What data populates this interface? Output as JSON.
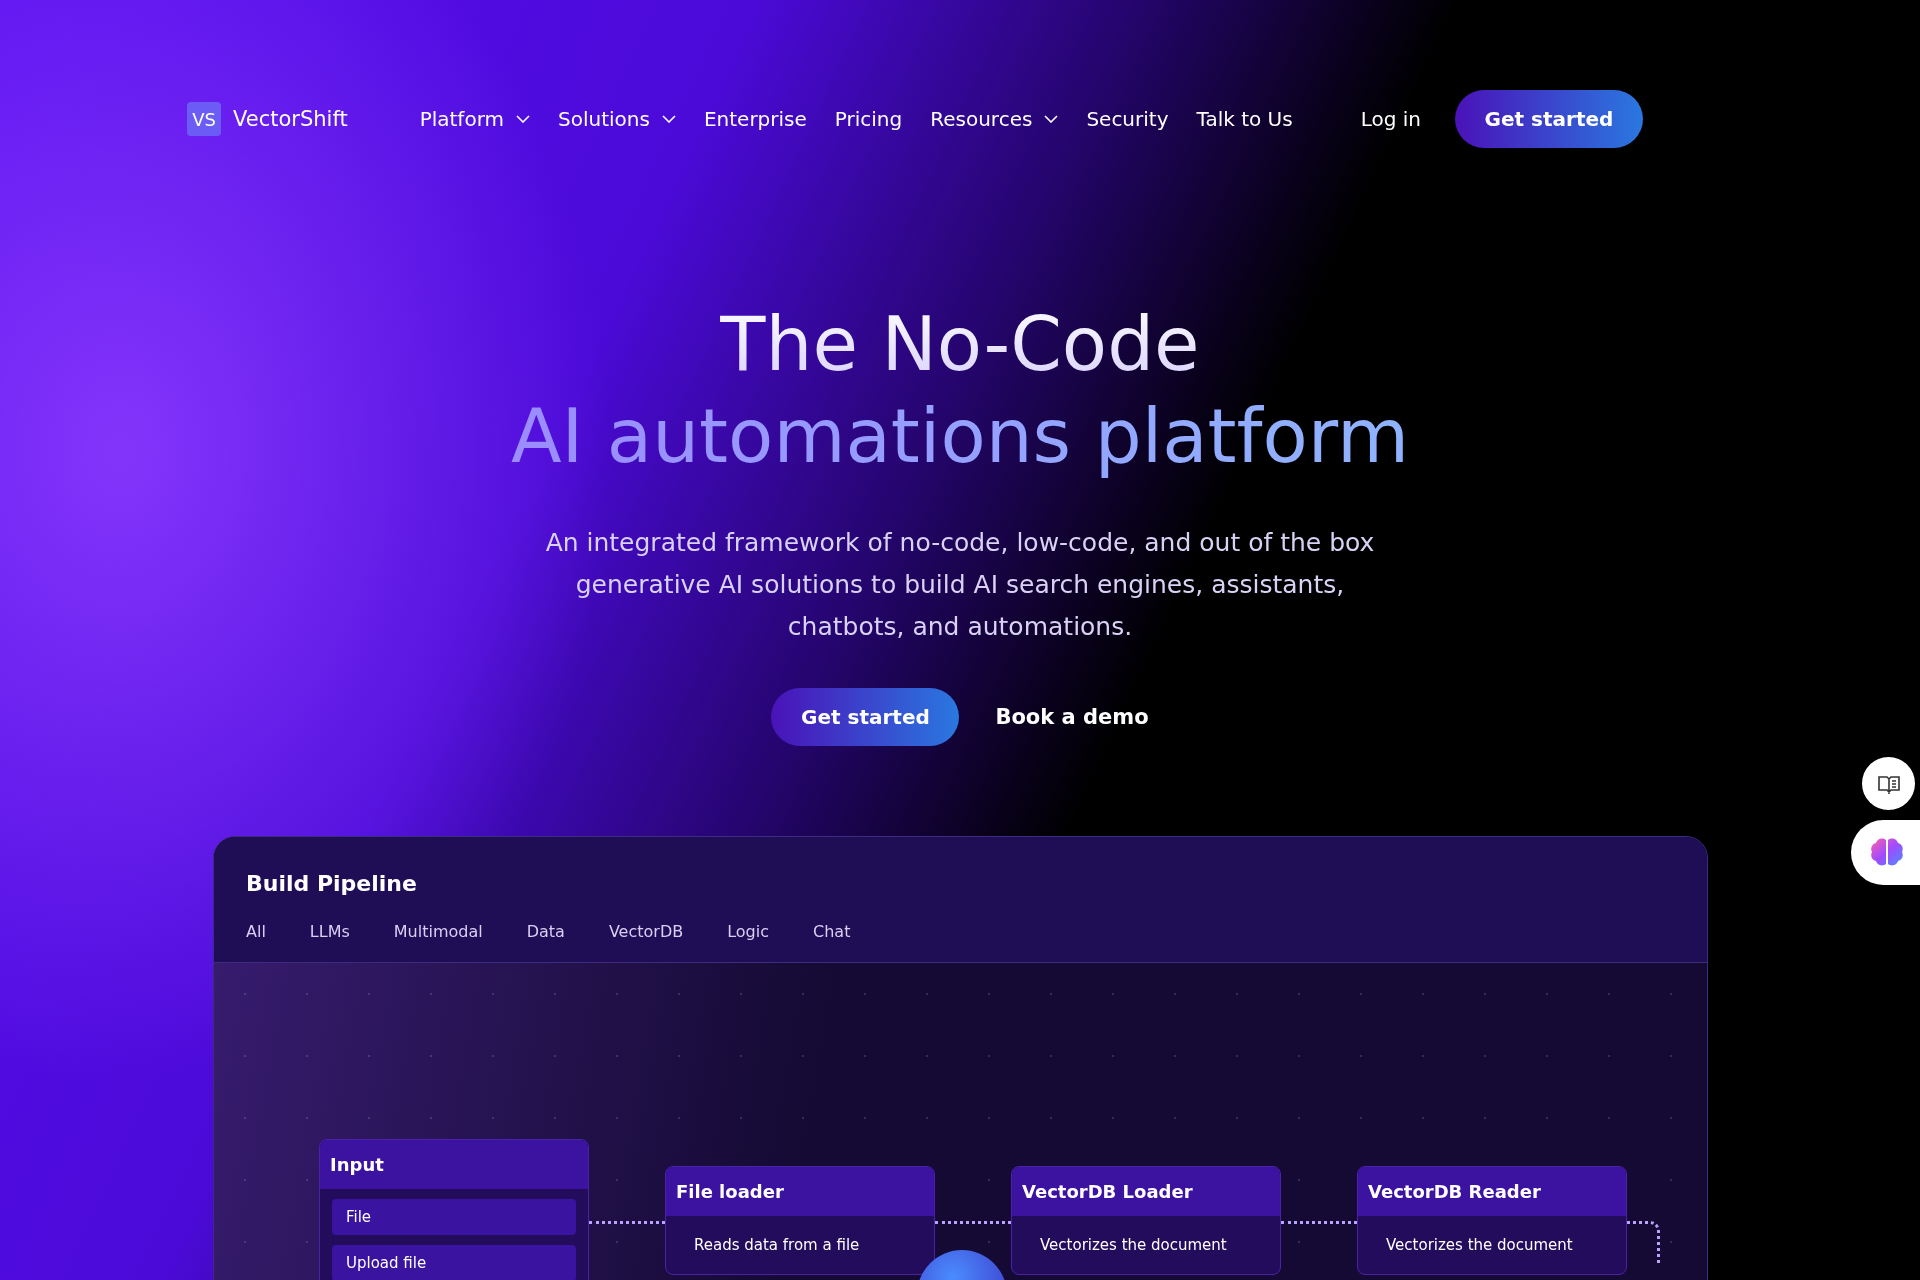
{
  "nav": {
    "logo_mark": "VS",
    "logo_text": "VectorShift",
    "links": [
      {
        "label": "Platform",
        "dropdown": true
      },
      {
        "label": "Solutions",
        "dropdown": true
      },
      {
        "label": "Enterprise",
        "dropdown": false
      },
      {
        "label": "Pricing",
        "dropdown": false
      },
      {
        "label": "Resources",
        "dropdown": true
      },
      {
        "label": "Security",
        "dropdown": false
      },
      {
        "label": "Talk to Us",
        "dropdown": false
      }
    ],
    "login": "Log in",
    "cta": "Get started"
  },
  "hero": {
    "title_line1": "The No-Code",
    "title_line2": "AI automations platform",
    "subtitle": "An integrated framework of no-code, low-code, and out of the box generative AI solutions to build AI search engines, assistants, chatbots, and automations.",
    "primary_button": "Get started",
    "secondary_button": "Book a demo"
  },
  "pipeline": {
    "title": "Build Pipeline",
    "tabs": [
      "All",
      "LLMs",
      "Multimodal",
      "Data",
      "VectorDB",
      "Logic",
      "Chat"
    ],
    "nodes": [
      {
        "kind": "input",
        "title": "Input",
        "items": [
          "File",
          "Upload file"
        ]
      },
      {
        "kind": "process",
        "title": "File loader",
        "description": "Reads data from a file"
      },
      {
        "kind": "process",
        "title": "VectorDB Loader",
        "description": "Vectorizes the document"
      },
      {
        "kind": "process",
        "title": "VectorDB Reader",
        "description": "Vectorizes the document"
      }
    ]
  }
}
